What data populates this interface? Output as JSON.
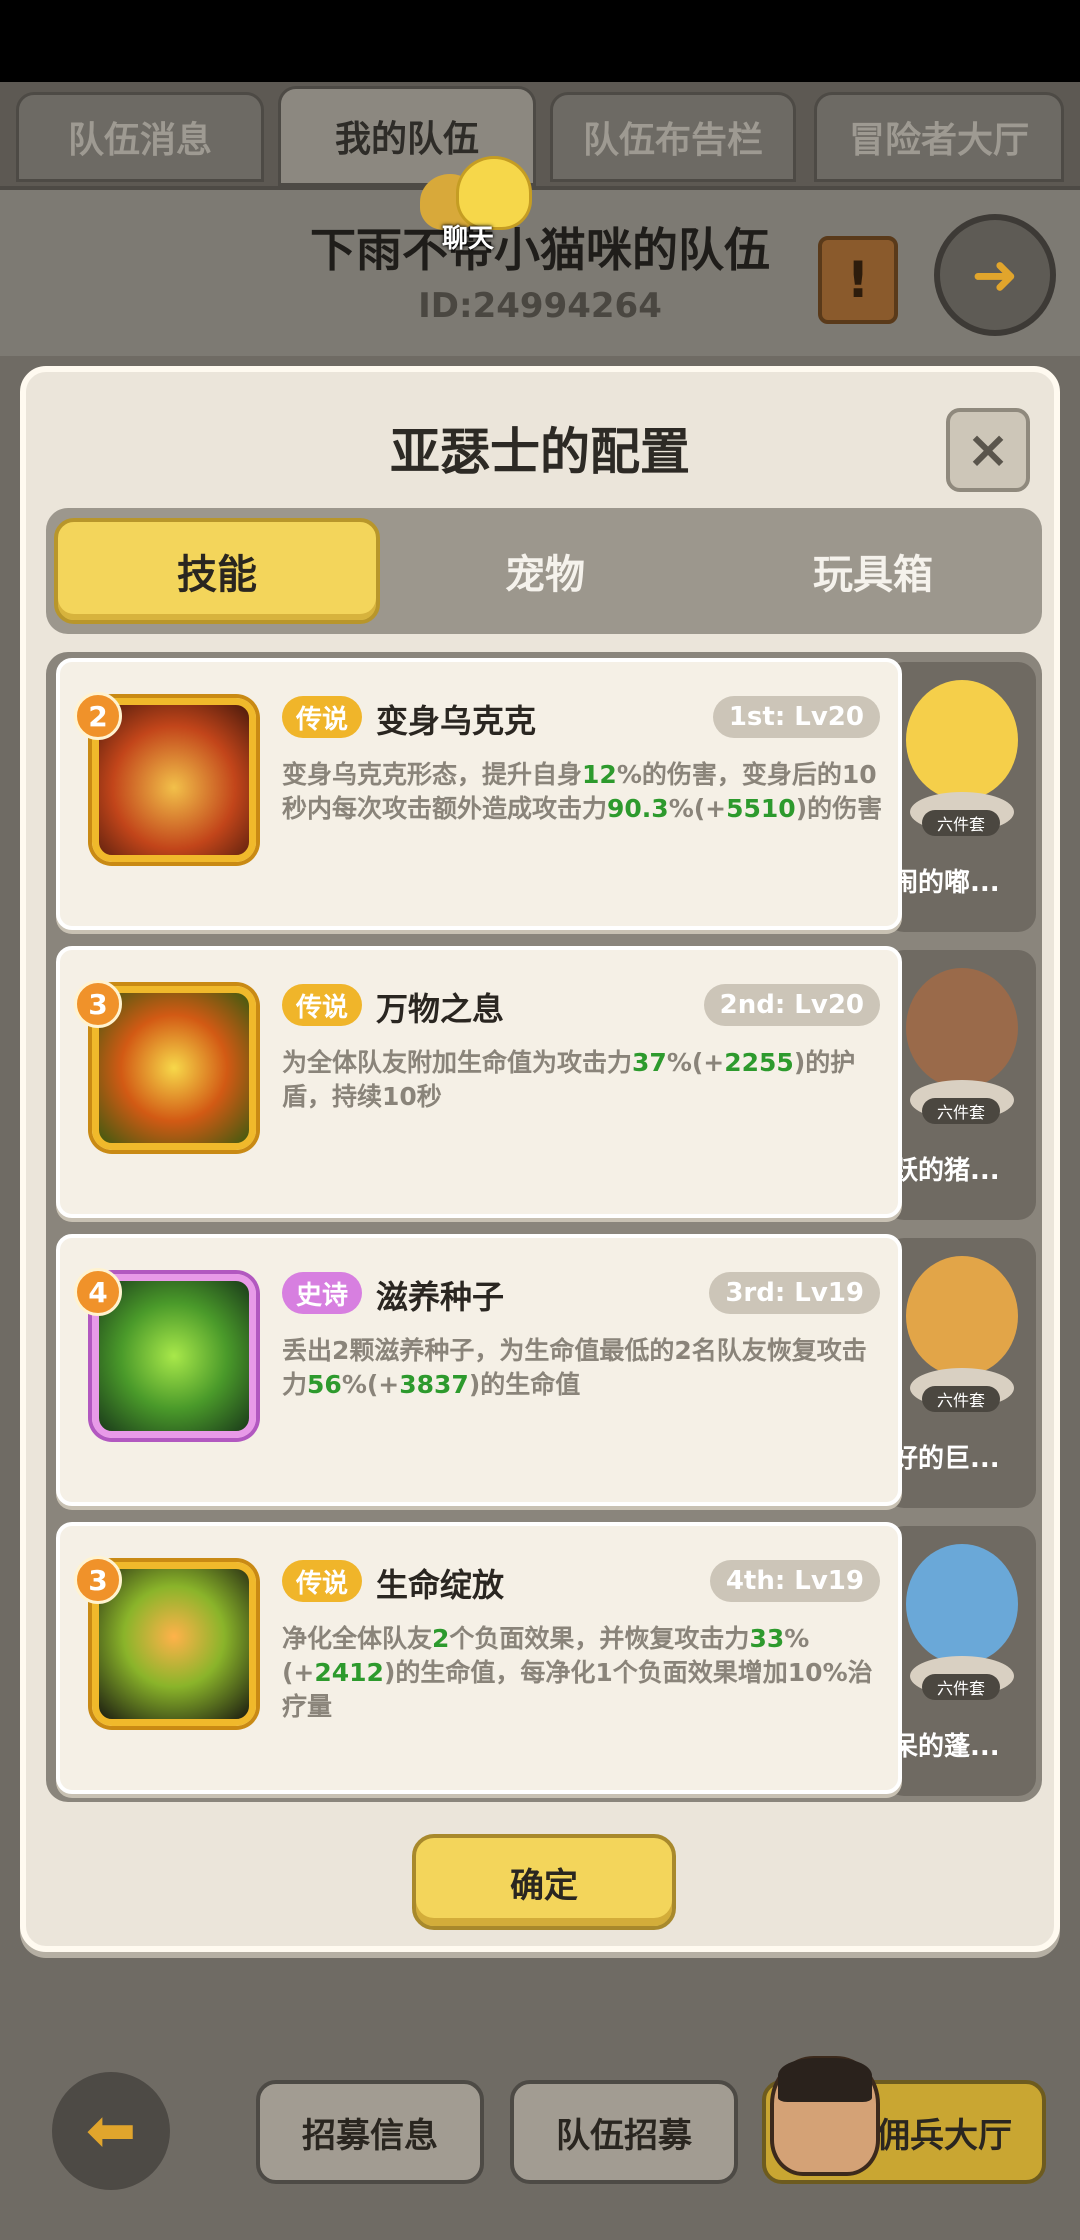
{
  "top_tabs": [
    "队伍消息",
    "我的队伍",
    "队伍布告栏",
    "冒险者大厅"
  ],
  "team": {
    "name": "下雨不带小猫咪的队伍",
    "id": "ID:24994264"
  },
  "chat_label": "聊天",
  "modal": {
    "title": "亚瑟士的配置",
    "close": "×",
    "tabs": [
      "技能",
      "宠物",
      "玩具箱"
    ],
    "skills": [
      {
        "level": "2",
        "rarity": "传说",
        "name": "变身乌克克",
        "slot": "1st: Lv20",
        "desc_parts": [
          "变身乌克克形态，提升自身",
          "12",
          "%的伤害，变身后的10秒内每次攻击额外造成攻击力",
          "90.3",
          "%(+",
          "5510",
          ")的伤害"
        ]
      },
      {
        "level": "3",
        "rarity": "传说",
        "name": "万物之息",
        "slot": "2nd: Lv20",
        "desc_parts": [
          "为全体队友附加生命值为攻击力",
          "37",
          "%(+",
          "2255",
          ")的护盾，持续10秒"
        ]
      },
      {
        "level": "4",
        "rarity": "史诗",
        "name": "滋养种子",
        "slot": "3rd: Lv19",
        "desc_parts": [
          "丢出2颗滋养种子，为生命值最低的2名队友恢复攻击力",
          "56",
          "%(+",
          "3837",
          ")的生命值"
        ]
      },
      {
        "level": "3",
        "rarity": "传说",
        "name": "生命绽放",
        "slot": "4th: Lv19",
        "desc_parts": [
          "净化全体队友",
          "2",
          "个负面效果，并恢复攻击力",
          "33",
          "%(+",
          "2412",
          ")的生命值，每净化1个负面效果增加10%治疗量"
        ]
      }
    ],
    "pets": [
      {
        "set": "六件套",
        "name": "吵闹的嘟...",
        "color": "#f5cf4a"
      },
      {
        "set": "六件套",
        "name": "活跃的猪...",
        "color": "#9a6a4a"
      },
      {
        "set": "六件套",
        "name": "友好的巨...",
        "color": "#e2a548"
      },
      {
        "set": "六件套",
        "name": "发呆的蓬...",
        "color": "#6aa8d8"
      }
    ],
    "confirm": "确定"
  },
  "bottom": {
    "back_icon": "arrow-left-icon",
    "buttons": [
      "招募信息",
      "队伍招募",
      "佣兵大厅"
    ]
  }
}
